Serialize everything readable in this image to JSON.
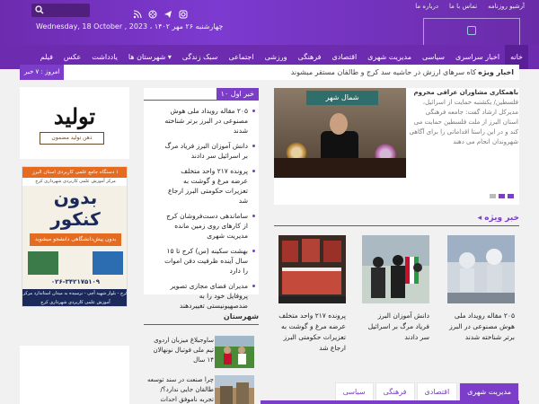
{
  "header": {
    "top_links": [
      "درباره ما",
      "تماس با ما",
      "آرشیو روزنامه"
    ],
    "date_text": "چهارشنبه ۲۶ مهر ۱۴۰۲ ، Wednesday, 18 October , 2023"
  },
  "nav": {
    "items": [
      "خانه",
      "اخبار سراسری",
      "سیاسی",
      "مدیریت شهری",
      "اقتصادی",
      "فرهنگی",
      "ورزشی",
      "اجتماعی",
      "سبک زندگی",
      "شهرستان ها ▾",
      "یادداشت",
      "عکس",
      "فیلم"
    ]
  },
  "ticker": {
    "label": "اخبار ویژه",
    "text": "کاه سرهای ارزش در حاشیه سد کرج و طالقان مستقر میشوند",
    "today": "امروز : ۷ خبر"
  },
  "slider": {
    "sign_text": "شمال شهر",
    "caption_title": "باهمکاری مشاوران عراقی محروم",
    "caption_body": "فلسطین/ یکشنبه حمایت از اسرائیل، مدیرکل ارشاد گفت: جامعه فرهنگی استان البرز از ملت فلسطین حمایت می کند و در این راستا اقداماتی را برای آگاهی شهروندان انجام می دهند"
  },
  "top10": {
    "header": "۱۰ خبر اول",
    "items": [
      "۲۰۵ مقاله رویداد ملی هوش مصنوعی در البرز برتر شناخته شدند",
      "دانش آموزان البرز فریاد مرگ بر اسرائیل سر دادند",
      "پرونده ۲۱۷ واحد متخلف عرضه مرغ و گوشت به تعزیرات حکومتی البرز ارجاع شد",
      "ساماندهی دست‌فروشان کرج از کارهای روی زمین مانده مدیریت شهری",
      "بهشت سکینه (س) کرج تا ۱۵ سال آینده ظرفیت دفن اموات را دارد",
      "مدیران فضای مجازی تصویر پروفایل خود را به ضدصهیونیستی تغییردهند"
    ]
  },
  "ad": {
    "logo_text": "تولید",
    "badge_text": "ذهن تولید مضمون",
    "strip": "۱ دستگاه جامع علمی کاربردی استان البرز",
    "strip2": "مرکز آموزش علمی کاربردی شهرداری کرج",
    "head1": "بدون",
    "head2": "کنکور",
    "sub": "بدون پیش‌دانشگاهی دانشجو میشوید",
    "phone": "۰۲۶-۳۴۲۱۷۵۱۰۹",
    "foot": "کرج - بلوار شهید آچی - نرسیده به میدان استاندارد مرکز آموزش علمی کاربردی شهرداری کرج"
  },
  "special": {
    "header": "خبر ویژه",
    "cards": [
      {
        "caption": "۲۰۵ مقاله رویداد ملی هوش مصنوعی در البرز برتر شناخته شدند"
      },
      {
        "caption": "دانش آموزان البرز فریاد مرگ بر اسرائیل سر دادند"
      },
      {
        "caption": "پرونده ۲۱۷ واحد متخلف عرضه مرغ و گوشت به تعزیرات حکومتی البرز ارجاع شد"
      }
    ]
  },
  "city": {
    "header": "شهرستان",
    "items": [
      {
        "text": "ساوجبلاغ میزبان اردوی تیم ملی فوتبال نونهالان ۱۴ سال"
      },
      {
        "text": "چرا صنعت در سند توسعه طالقان جایی ندارد؟/ تجربه ناموفق احداث شهرک صنعتی"
      }
    ]
  },
  "bottom_tabs": [
    "مدیریت شهری",
    "اقتصادی",
    "فرهنگی",
    "سیاسی"
  ],
  "colors": {
    "brand": "#7c3dc8",
    "nav": "#6d2bb0"
  }
}
